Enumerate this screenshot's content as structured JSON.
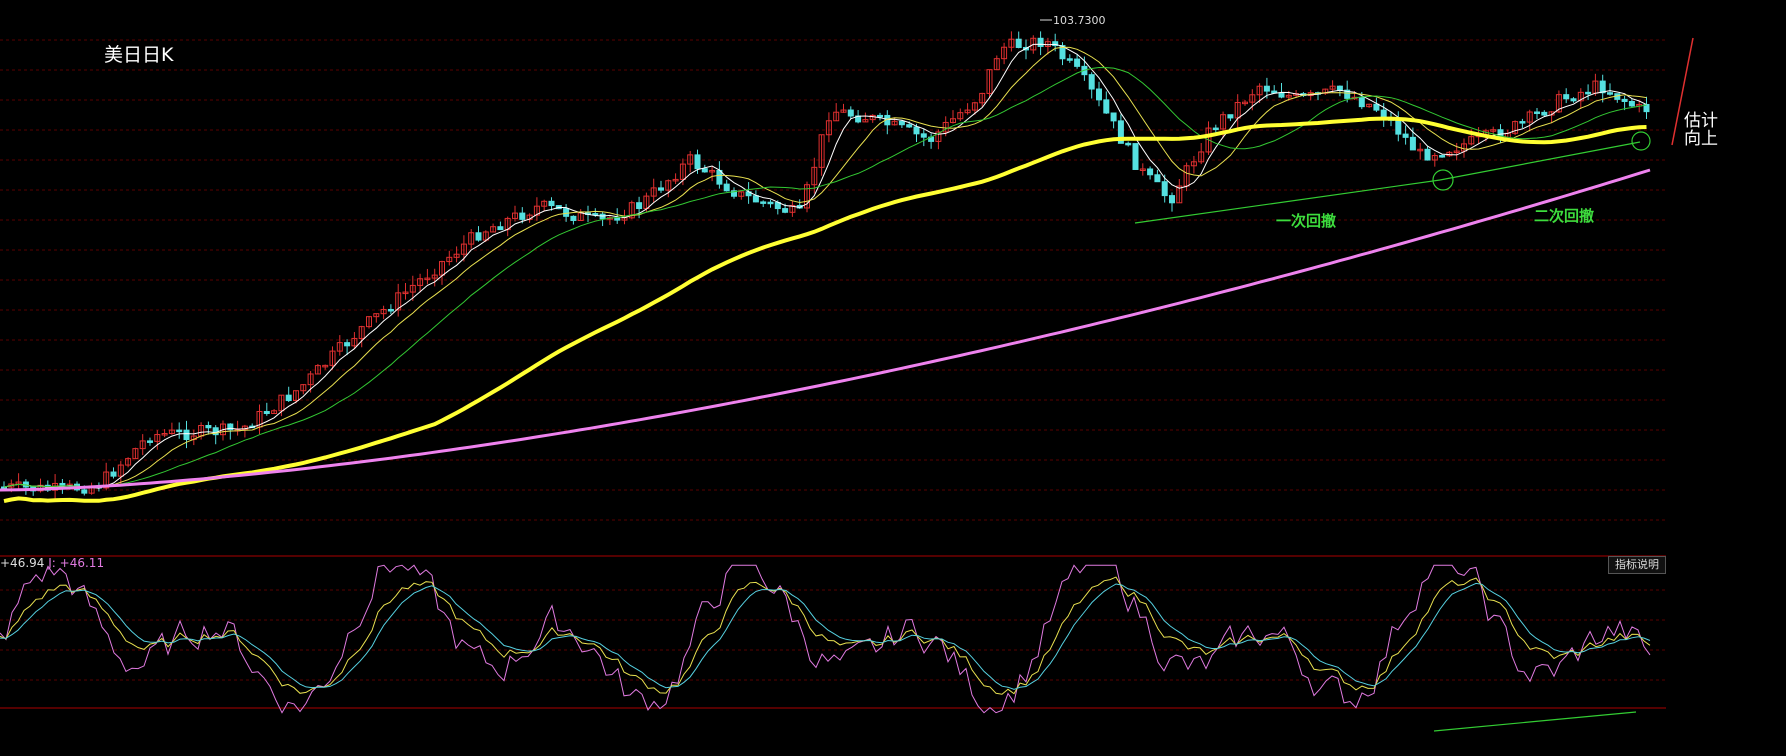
{
  "title": "美日日K",
  "note": "估计\n向上",
  "indicator_help_label": "指标说明",
  "readout": {
    "k_value": "+46.94",
    "j_label": "J:",
    "j_value": "+46.11"
  },
  "peak_label": "103.7300",
  "annotations": {
    "first_pullback": "一次回撤",
    "second_pullback": "二次回撤"
  },
  "colors": {
    "background": "#000000",
    "grid": "#5a0000",
    "up": "#e03030",
    "down": "#55e0e0",
    "ma5": "#ffffff",
    "ma10": "#e8e050",
    "ma20": "#33c833",
    "ma60": "#ffff33",
    "ma250": "#ee82ee",
    "trend": "#33cc33",
    "k": "#ffffff",
    "d": "#e8e050",
    "j": "#e07ae0"
  },
  "chart_data": [
    {
      "type": "candlestick",
      "title": "美日日K",
      "series_count": 5,
      "peak": {
        "value": 103.73
      },
      "annotations": [
        "一次回撤",
        "二次回撤"
      ]
    },
    {
      "type": "line",
      "ylim": [
        0,
        100
      ],
      "series": [
        {
          "values": []
        },
        {
          "values": []
        },
        {
          "values": []
        }
      ]
    }
  ]
}
